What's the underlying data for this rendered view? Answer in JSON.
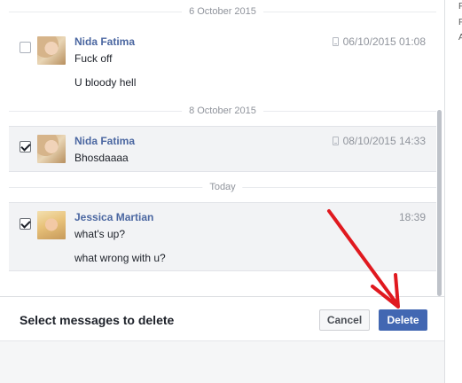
{
  "separators": {
    "first": "6 October 2015",
    "second": "8 October 2015",
    "third": "Today"
  },
  "messages": [
    {
      "sender": "Nida Fatima",
      "time": "06/10/2015 01:08",
      "lines": [
        "Fuck off",
        "U bloody hell"
      ],
      "checked": false,
      "via_mobile": true
    },
    {
      "sender": "Nida Fatima",
      "time": "08/10/2015 14:33",
      "lines": [
        "Bhosdaaaa"
      ],
      "checked": true,
      "via_mobile": true
    },
    {
      "sender": "Jessica Martian",
      "time": "18:39",
      "lines": [
        "what's up?",
        "what wrong with u?"
      ],
      "checked": true,
      "via_mobile": false
    }
  ],
  "footer": {
    "prompt": "Select messages to delete",
    "cancel_label": "Cancel",
    "delete_label": "Delete"
  },
  "right_edge_letters": [
    "F",
    "F",
    "A"
  ],
  "icons": {
    "mobile": "phone-icon",
    "annotation": "red-arrow"
  },
  "colors": {
    "name": "#4b67a1",
    "delete_button": "#4267b2",
    "arrow": "#e0191f"
  }
}
